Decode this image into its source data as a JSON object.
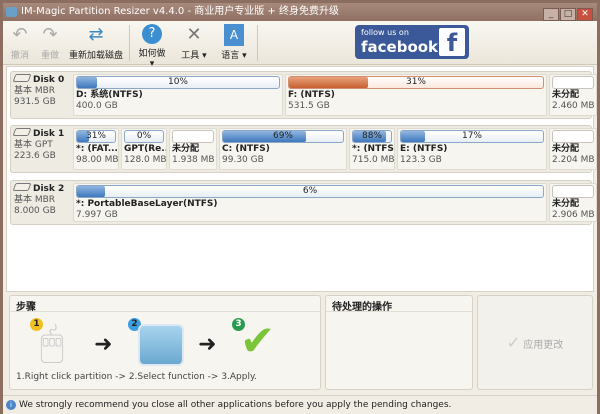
{
  "window": {
    "title": "IM-Magic Partition Resizer v4.4.0 - 商业用户专业版 + 终身免费升级",
    "min": "_",
    "max": "□",
    "close": "✕"
  },
  "toolbar": {
    "undo": "撤消",
    "redo": "重做",
    "reload": "重新加载磁盘",
    "howto": "如何做",
    "tools": "工具",
    "language": "语言",
    "facebook_small": "follow us on",
    "facebook_big": "facebook",
    "facebook_f": "f"
  },
  "disks": [
    {
      "name": "Disk 0",
      "type": "基本 MBR",
      "size": "931.5 GB",
      "partitions": [
        {
          "label": "D: 系统(NTFS)",
          "size": "400.0 GB",
          "percent": 10,
          "text": "10%",
          "style": "blue"
        },
        {
          "label": "F: (NTFS)",
          "size": "531.5 GB",
          "percent": 31,
          "text": "31%",
          "style": "orange"
        },
        {
          "label": "未分配",
          "size": "2.460 MB",
          "percent": 0,
          "text": "",
          "style": "empty"
        }
      ]
    },
    {
      "name": "Disk 1",
      "type": "基本 GPT",
      "size": "223.6 GB",
      "partitions": [
        {
          "label": "*: (FAT...",
          "size": "98.00 MB",
          "percent": 31,
          "text": "31%",
          "style": "blue"
        },
        {
          "label": "GPT(Re...",
          "size": "128.0 MB",
          "percent": 0,
          "text": "0%",
          "style": "blue"
        },
        {
          "label": "未分配",
          "size": "1.938 MB",
          "percent": 0,
          "text": "",
          "style": "empty"
        },
        {
          "label": "C: (NTFS)",
          "size": "99.30 GB",
          "percent": 69,
          "text": "69%",
          "style": "blue"
        },
        {
          "label": "*: (NTFS)",
          "size": "715.0 MB",
          "percent": 88,
          "text": "88%",
          "style": "blue"
        },
        {
          "label": "E: (NTFS)",
          "size": "123.3 GB",
          "percent": 17,
          "text": "17%",
          "style": "blue"
        },
        {
          "label": "未分配",
          "size": "2.204 MB",
          "percent": 0,
          "text": "",
          "style": "empty"
        }
      ]
    },
    {
      "name": "Disk 2",
      "type": "基本 MBR",
      "size": "8.000 GB",
      "partitions": [
        {
          "label": "*: PortableBaseLayer(NTFS)",
          "size": "7.997 GB",
          "percent": 6,
          "text": "6%",
          "style": "blue"
        },
        {
          "label": "未分配",
          "size": "2.906 MB",
          "percent": 0,
          "text": "",
          "style": "empty"
        }
      ]
    }
  ],
  "steps": {
    "title": "步骤",
    "n1": "1",
    "n2": "2",
    "n3": "3",
    "caption": "1.Right click partition -> 2.Select function -> 3.Apply."
  },
  "pending": {
    "title": "待处理的操作"
  },
  "apply": {
    "label": "应用更改"
  },
  "status": {
    "text": "We strongly recommend you close all other applications before you apply the pending changes."
  }
}
